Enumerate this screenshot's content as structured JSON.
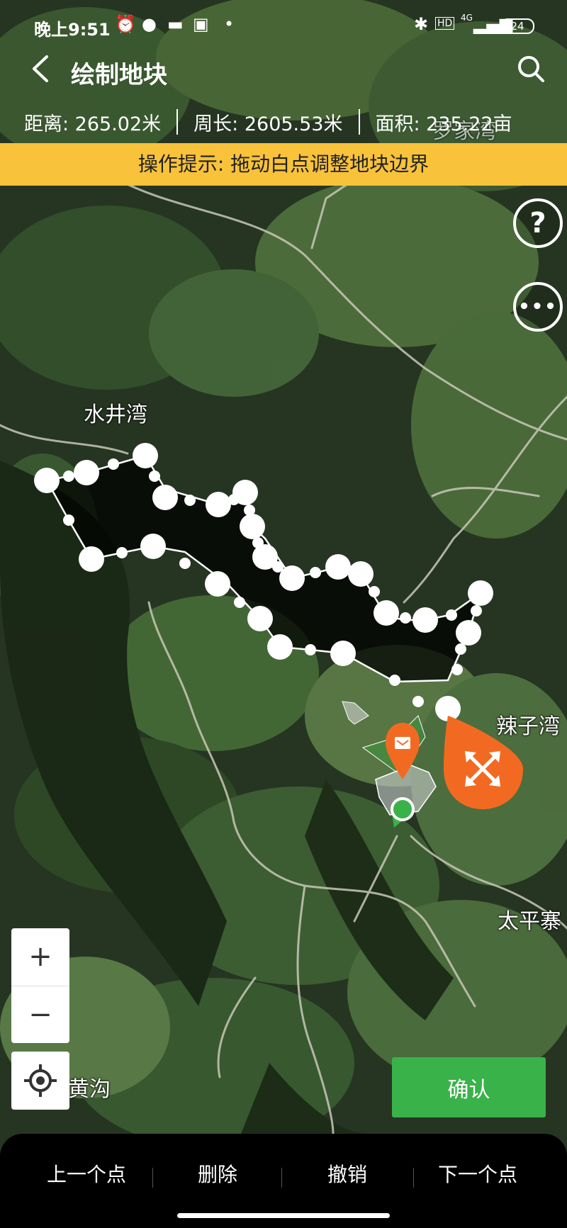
{
  "status_bar": {
    "time": "晚上9:51",
    "icons": [
      "alarm-icon",
      "wechat-icon",
      "message-icon",
      "app-icon",
      "dot-icon",
      "bluetooth-icon",
      "hd-icon",
      "signal-4g-icon"
    ],
    "battery": "24",
    "network": "4G",
    "hd": "HD"
  },
  "header": {
    "title": "绘制地块",
    "back_icon": "back-arrow-icon",
    "search_icon": "search-icon"
  },
  "metrics": {
    "distance": "距离: 265.02米",
    "perimeter": "周长: 2605.53米",
    "area": "面积: 235.22亩"
  },
  "tip": "操作提示: 拖动白点调整地块边界",
  "map": {
    "place_labels": [
      "水井湾",
      "辣子湾",
      "太平寨",
      "黄沟",
      "罗家湾"
    ],
    "help_icon": "help-icon",
    "more_icon": "more-icon",
    "move_marker_icon": "move-icon",
    "house_marker_icon": "house-marker-icon"
  },
  "controls": {
    "zoom_in": "+",
    "zoom_out": "−",
    "locate_icon": "locate-icon",
    "confirm": "确认"
  },
  "bottom_bar": {
    "prev": "上一个点",
    "delete": "删除",
    "undo": "撤销",
    "next": "下一个点"
  },
  "colors": {
    "tip_bg": "#f8c23a",
    "confirm_bg": "#3ab24a",
    "marker_orange": "#f26a21",
    "map_dark": "#1e2b18"
  }
}
